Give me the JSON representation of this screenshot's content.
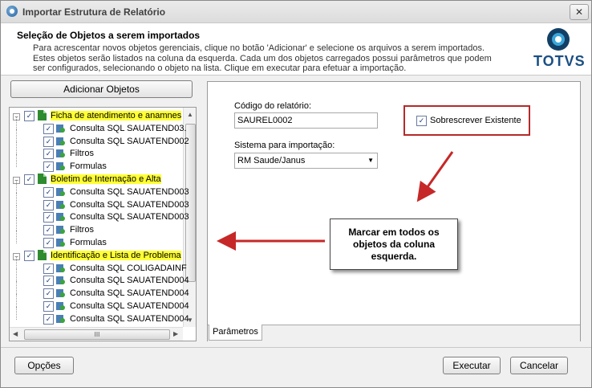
{
  "window": {
    "title": "Importar Estrutura de Relatório",
    "close_label": "✕"
  },
  "header": {
    "title": "Seleção de Objetos a serem importados",
    "description": "Para acrescentar novos objetos gerenciais, clique no botão 'Adicionar' e selecione os arquivos a serem importados. Estes objetos serão listados na coluna da esquerda. Cada um dos objetos carregados possui parâmetros que podem ser configurados, selecionando o objeto na lista. Clique em executar para efetuar a importação.",
    "logo_text": "TOTVS"
  },
  "add_objects_label": "Adicionar Objetos",
  "tree": {
    "groups": [
      {
        "label": "Ficha de atendimento e anamnes",
        "expander": "−",
        "checked": "✓",
        "children": [
          "Consulta SQL SAUATEND03.",
          "Consulta SQL SAUATEND002",
          "Filtros",
          "Formulas"
        ]
      },
      {
        "label": "Boletim de Internação e Alta",
        "expander": "−",
        "checked": "✓",
        "children": [
          "Consulta SQL SAUATEND003",
          "Consulta SQL SAUATEND003",
          "Consulta SQL SAUATEND003",
          "Filtros",
          "Formulas"
        ]
      },
      {
        "label": "Identificação e Lista de Problema",
        "expander": "−",
        "checked": "✓",
        "children": [
          "Consulta SQL COLIGADAINF",
          "Consulta SQL SAUATEND004",
          "Consulta SQL SAUATEND004",
          "Consulta SQL SAUATEND004",
          "Consulta SQL SAUATEND004"
        ]
      }
    ],
    "scroll_thumb_glyph": "III"
  },
  "form": {
    "report_code_label": "Código do relatório:",
    "report_code_value": "SAUREL0002",
    "overwrite_label": "Sobrescrever Existente",
    "overwrite_checked": "✓",
    "system_label": "Sistema para importação:",
    "system_value": "RM Saude/Janus"
  },
  "tabs": {
    "params": "Parâmetros"
  },
  "callout": {
    "text": "Marcar em todos os objetos da coluna esquerda."
  },
  "footer": {
    "options": "Opções",
    "execute": "Executar",
    "cancel": "Cancelar"
  },
  "colors": {
    "highlight": "#ffff33",
    "callout_border": "#b52a2a",
    "arrow": "#c62828",
    "brand": "#1b4f82"
  }
}
